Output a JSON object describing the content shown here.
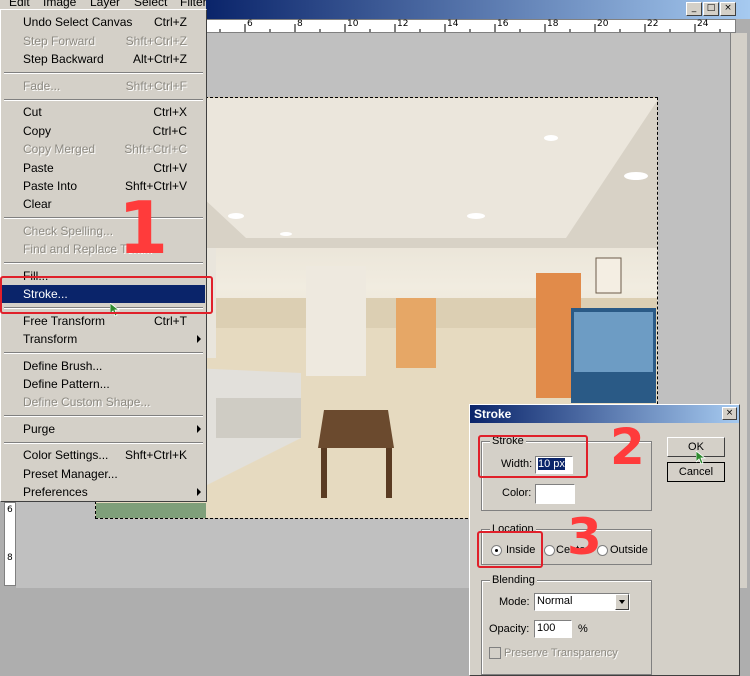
{
  "menubar": {
    "items": [
      "Edit",
      "Image",
      "Layer",
      "Select",
      "Filter"
    ]
  },
  "ruler": {
    "top_labels": [
      "6",
      "8",
      "10",
      "12",
      "14",
      "16",
      "18",
      "20",
      "22",
      "24"
    ],
    "left_labels": [
      "6",
      "8"
    ]
  },
  "window": {
    "minimize": "_",
    "maximize": "□",
    "close": "×"
  },
  "edit_menu": {
    "items": [
      {
        "label": "Undo Select Canvas",
        "shortcut": "Ctrl+Z",
        "enabled": true
      },
      {
        "label": "Step Forward",
        "shortcut": "Shft+Ctrl+Z",
        "enabled": false
      },
      {
        "label": "Step Backward",
        "shortcut": "Alt+Ctrl+Z",
        "enabled": true
      },
      {
        "label": "Fade...",
        "shortcut": "Shft+Ctrl+F",
        "enabled": false
      },
      {
        "label": "Cut",
        "shortcut": "Ctrl+X",
        "enabled": true
      },
      {
        "label": "Copy",
        "shortcut": "Ctrl+C",
        "enabled": true
      },
      {
        "label": "Copy Merged",
        "shortcut": "Shft+Ctrl+C",
        "enabled": false
      },
      {
        "label": "Paste",
        "shortcut": "Ctrl+V",
        "enabled": true
      },
      {
        "label": "Paste Into",
        "shortcut": "Shft+Ctrl+V",
        "enabled": true
      },
      {
        "label": "Clear",
        "shortcut": "",
        "enabled": true
      },
      {
        "label": "Check Spelling...",
        "shortcut": "",
        "enabled": false
      },
      {
        "label": "Find and Replace Text...",
        "shortcut": "",
        "enabled": false
      },
      {
        "label": "Fill...",
        "shortcut": "",
        "enabled": true
      },
      {
        "label": "Stroke...",
        "shortcut": "",
        "enabled": true,
        "selected": true
      },
      {
        "label": "Free Transform",
        "shortcut": "Ctrl+T",
        "enabled": true
      },
      {
        "label": "Transform",
        "shortcut": "",
        "enabled": true,
        "submenu": true
      },
      {
        "label": "Define Brush...",
        "shortcut": "",
        "enabled": true
      },
      {
        "label": "Define Pattern...",
        "shortcut": "",
        "enabled": true
      },
      {
        "label": "Define Custom Shape...",
        "shortcut": "",
        "enabled": false
      },
      {
        "label": "Purge",
        "shortcut": "",
        "enabled": true,
        "submenu": true
      },
      {
        "label": "Color Settings...",
        "shortcut": "Shft+Ctrl+K",
        "enabled": true
      },
      {
        "label": "Preset Manager...",
        "shortcut": "",
        "enabled": true
      },
      {
        "label": "Preferences",
        "shortcut": "",
        "enabled": true,
        "submenu": true
      }
    ]
  },
  "stroke_dialog": {
    "title": "Stroke",
    "stroke_group": "Stroke",
    "width_label": "Width:",
    "width_value": "10 px",
    "color_label": "Color:",
    "color_value": "#ffffff",
    "location_group": "Location",
    "location_options": [
      "Inside",
      "Center",
      "Outside"
    ],
    "location_selected": "Inside",
    "blending_group": "Blending",
    "mode_label": "Mode:",
    "mode_value": "Normal",
    "opacity_label": "Opacity:",
    "opacity_value": "100",
    "opacity_unit": "%",
    "preserve_label": "Preserve Transparency",
    "preserve_checked": false,
    "ok_label": "OK",
    "cancel_label": "Cancel"
  },
  "annotations": {
    "step1": "1",
    "step2": "2",
    "step3": "3",
    "color": "#e0202a"
  }
}
